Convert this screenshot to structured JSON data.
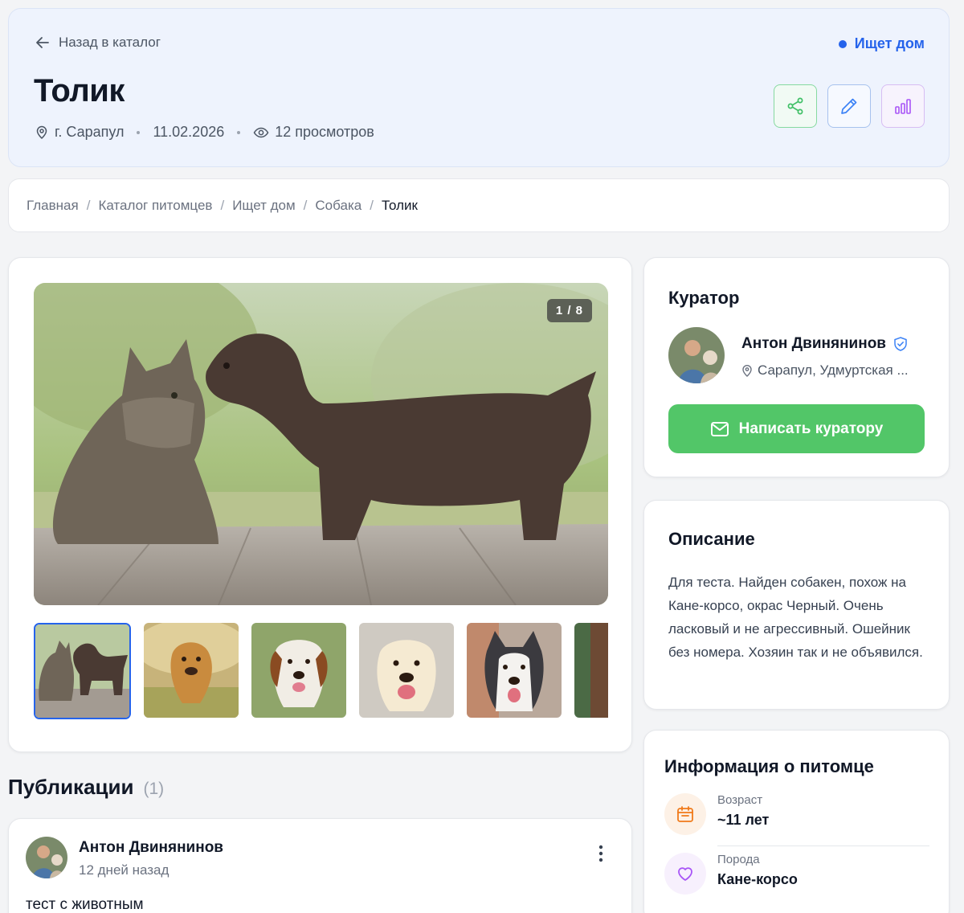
{
  "header": {
    "back_label": "Назад в каталог",
    "status_label": "Ищет дом",
    "title": "Толик",
    "city": "г. Сарапул",
    "date": "11.02.2026",
    "views": "12 просмотров"
  },
  "breadcrumb": [
    "Главная",
    "Каталог питомцев",
    "Ищет дом",
    "Собака",
    "Толик"
  ],
  "gallery": {
    "counter": "1 / 8"
  },
  "curator": {
    "title": "Куратор",
    "name": "Антон Двинянинов",
    "location": "Сарапул, Удмуртская ...",
    "write_button": "Написать куратору"
  },
  "description": {
    "title": "Описание",
    "text": "Для теста. Найден собакен, похож на Кане-корсо, окрас Черный. Очень ласковый и не агрессивный. Ошейник без номера. Хозяин так и не объявился."
  },
  "info": {
    "title": "Информация о питомце",
    "rows": [
      {
        "label": "Возраст",
        "value": "~11 лет",
        "icon": "calendar-icon"
      },
      {
        "label": "Порода",
        "value": "Кане-корсо",
        "icon": "heart-icon"
      }
    ]
  },
  "publications": {
    "title": "Публикации",
    "count": "(1)",
    "posts": [
      {
        "author": "Антон Двинянинов",
        "time": "12 дней назад",
        "text": "тест с животным"
      }
    ]
  },
  "colors": {
    "accent": "#2563eb",
    "green": "#52c668",
    "purple": "#a855f7"
  }
}
